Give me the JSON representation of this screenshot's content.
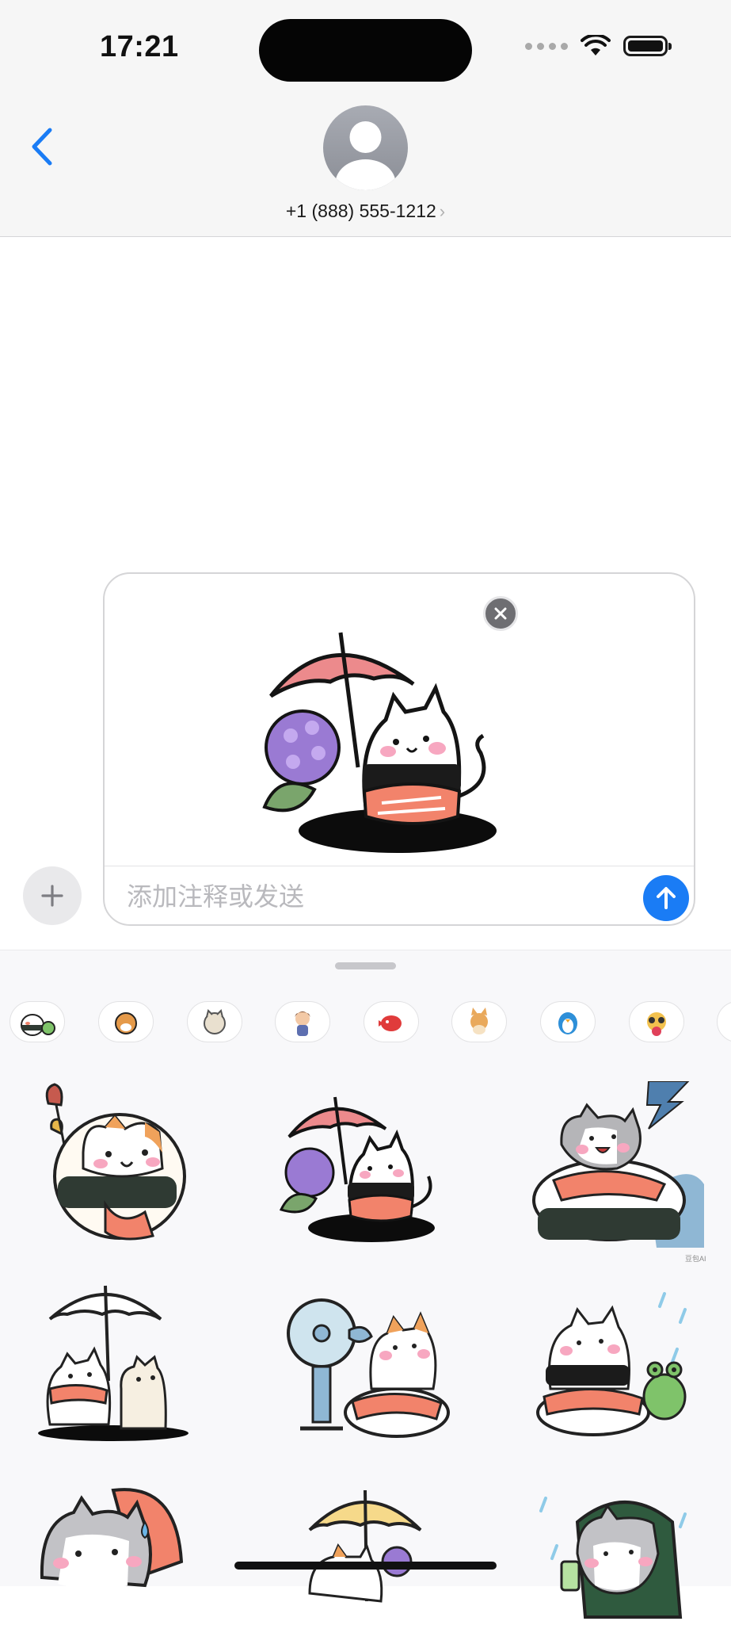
{
  "status_bar": {
    "time": "17:21",
    "icons": [
      "signal-icon",
      "wifi-icon",
      "battery-icon"
    ]
  },
  "header": {
    "back_icon": "chevron-left-icon",
    "contact_name": "+1 (888) 555-1212",
    "contact_chevron": "›"
  },
  "compose": {
    "placeholder": "添加注释或发送",
    "plus_icon": "plus-icon",
    "send_icon": "arrow-up-icon",
    "remove_icon": "close-icon",
    "attached_sticker": "rice-cat-with-umbrella-and-hydrangea"
  },
  "drawer": {
    "packs": [
      {
        "name": "sushi-cat-pack",
        "active": true
      },
      {
        "name": "shiba-pack",
        "active": false
      },
      {
        "name": "tabby-cat-pack",
        "active": false
      },
      {
        "name": "girl-pack",
        "active": false
      },
      {
        "name": "red-bird-pack",
        "active": false
      },
      {
        "name": "corgi-pack",
        "active": false
      },
      {
        "name": "penguin-pack",
        "active": false
      },
      {
        "name": "raccoon-pack",
        "active": false
      },
      {
        "name": "more-pack",
        "active": false
      }
    ],
    "stickers": [
      "sushi-cat-bells",
      "rice-cat-umbrella-hydrangea",
      "gray-cat-salmon-thunder",
      "rice-cat-white-umbrella",
      "cat-with-fan",
      "cat-with-frog-rain",
      "gray-cat-salmon-sweat",
      "cat-yellow-umbrella",
      "gray-cat-drink-rain"
    ],
    "watermark": "豆包AI"
  },
  "colors": {
    "accent": "#1a7cf5",
    "salmon": "#f2836b",
    "pink_umbrella": "#ec8a8c",
    "hydrangea": "#9a7ad3",
    "nori": "#2f3a33"
  }
}
